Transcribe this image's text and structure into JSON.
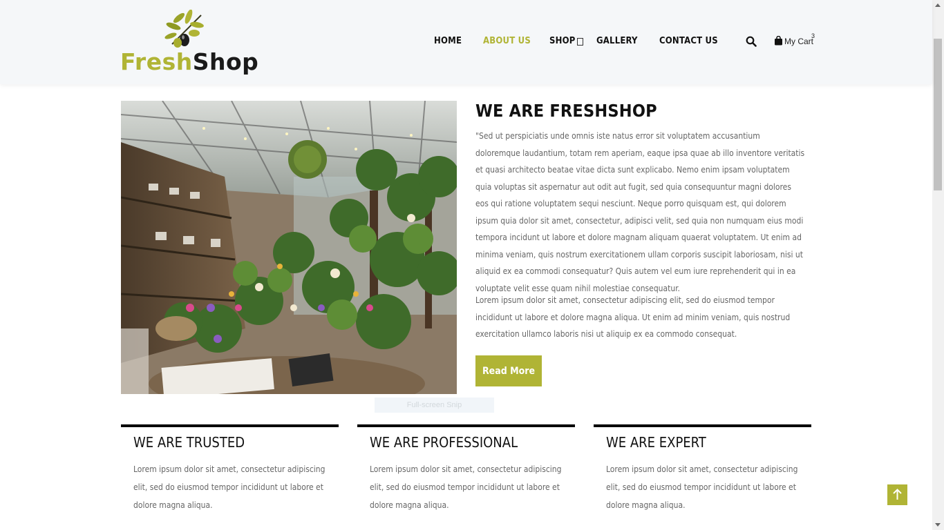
{
  "header": {
    "logo": {
      "word1": "Fresh",
      "word2": "Shop"
    },
    "nav": [
      {
        "label": "HOME",
        "active": false
      },
      {
        "label": "ABOUT US",
        "active": true
      },
      {
        "label": "SHOP",
        "active": false,
        "has_dropdown": true
      },
      {
        "label": "GALLERY",
        "active": false
      },
      {
        "label": "CONTACT US",
        "active": false
      }
    ],
    "cart": {
      "label": "My Cart",
      "count": "3"
    }
  },
  "about": {
    "title": "WE ARE FRESHSHOP",
    "paragraph1": "\"Sed ut perspiciatis unde omnis iste natus error sit voluptatem accusantium doloremque laudantium, totam rem aperiam, eaque ipsa quae ab illo inventore veritatis et quasi architecto beatae vitae dicta sunt explicabo. Nemo enim ipsam voluptatem quia voluptas sit aspernatur aut odit aut fugit, sed quia consequuntur magni dolores eos qui ratione voluptatem sequi nesciunt. Neque porro quisquam est, qui dolorem ipsum quia dolor sit amet, consectetur, adipisci velit, sed quia non numquam eius modi tempora incidunt ut labore et dolore magnam aliquam quaerat voluptatem. Ut enim ad minima veniam, quis nostrum exercitationem ullam corporis suscipit laboriosam, nisi ut aliquid ex ea commodi consequatur? Quis autem vel eum iure reprehenderit qui in ea voluptate velit esse quam nihil molestiae consequatur.",
    "paragraph2": "Lorem ipsum dolor sit amet, consectetur adipiscing elit, sed do eiusmod tempor incididunt ut labore et dolore magna aliqua. Ut enim ad minim veniam, quis nostrud exercitation ullamco laboris nisi ut aliquip ex ea commodo consequat.",
    "read_more_label": "Read More"
  },
  "overlay": {
    "snip_hint": "Full-screen Snip"
  },
  "features": [
    {
      "title": "WE ARE TRUSTED",
      "text": "Lorem ipsum dolor sit amet, consectetur adipiscing elit, sed do eiusmod tempor incididunt ut labore et dolore magna aliqua."
    },
    {
      "title": "WE ARE PROFESSIONAL",
      "text": "Lorem ipsum dolor sit amet, consectetur adipiscing elit, sed do eiusmod tempor incididunt ut labore et dolore magna aliqua."
    },
    {
      "title": "WE ARE EXPERT",
      "text": "Lorem ipsum dolor sit amet, consectetur adipiscing elit, sed do eiusmod tempor incididunt ut labore et dolore magna aliqua."
    }
  ],
  "icons": {
    "search": "search-icon",
    "cart": "shopping-bag-icon",
    "back_to_top": "arrow-up-icon",
    "dropdown": "dropdown-icon"
  },
  "colors": {
    "accent": "#b0b435",
    "header_bg": "#f5f7f9",
    "text": "#111111",
    "muted_text": "#666666"
  }
}
